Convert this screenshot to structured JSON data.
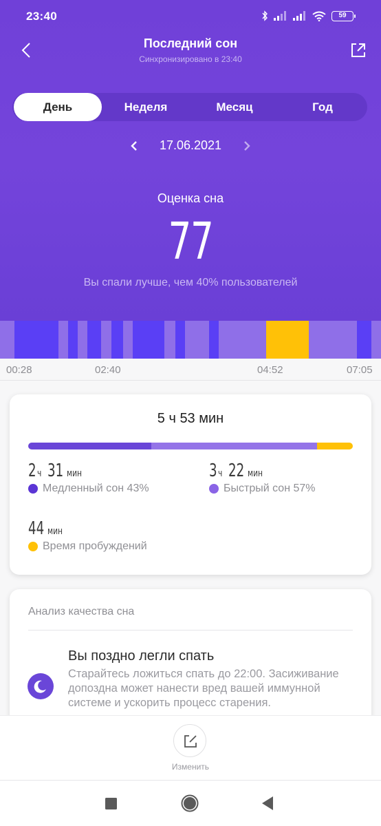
{
  "status_bar": {
    "time": "23:40",
    "battery_level": "59",
    "icons": [
      "bluetooth-icon",
      "signal-icon",
      "signal-icon",
      "wifi-icon",
      "battery-icon"
    ]
  },
  "header": {
    "title": "Последний сон",
    "subtitle": "Синхронизировано в 23:40",
    "back_icon": "chevron-left-icon",
    "share_icon": "share-icon"
  },
  "tabs": [
    {
      "label": "День",
      "active": true
    },
    {
      "label": "Неделя",
      "active": false
    },
    {
      "label": "Месяц",
      "active": false
    },
    {
      "label": "Год",
      "active": false
    }
  ],
  "date_nav": {
    "date": "17.06.2021",
    "prev_icon": "chevron-left-icon",
    "next_icon": "chevron-right-icon"
  },
  "score": {
    "label": "Оценка сна",
    "value": "77",
    "note": "Вы спали лучше, чем 40% пользователей"
  },
  "colors": {
    "deep": "#5a3ff5",
    "light": "#8f6fe8",
    "awake": "#ffc107",
    "deep_dot": "#5b35d5",
    "light_dot": "#8a64e6",
    "accent": "#7143da"
  },
  "chart_data": {
    "type": "timeline",
    "title": "",
    "x_start": "00:28",
    "x_end": "07:05",
    "total_minutes": 397,
    "tick_labels": [
      "00:28",
      "02:40",
      "04:52",
      "07:05"
    ],
    "segments": [
      {
        "stage": "light",
        "start_min": 0,
        "end_min": 15
      },
      {
        "stage": "deep",
        "start_min": 15,
        "end_min": 61
      },
      {
        "stage": "light",
        "start_min": 61,
        "end_min": 71
      },
      {
        "stage": "deep",
        "start_min": 71,
        "end_min": 81
      },
      {
        "stage": "light",
        "start_min": 81,
        "end_min": 91
      },
      {
        "stage": "deep",
        "start_min": 91,
        "end_min": 105
      },
      {
        "stage": "light",
        "start_min": 105,
        "end_min": 116
      },
      {
        "stage": "deep",
        "start_min": 116,
        "end_min": 128
      },
      {
        "stage": "light",
        "start_min": 128,
        "end_min": 138
      },
      {
        "stage": "deep",
        "start_min": 138,
        "end_min": 171
      },
      {
        "stage": "light",
        "start_min": 171,
        "end_min": 183
      },
      {
        "stage": "deep",
        "start_min": 183,
        "end_min": 193
      },
      {
        "stage": "light",
        "start_min": 193,
        "end_min": 218
      },
      {
        "stage": "deep",
        "start_min": 218,
        "end_min": 228
      },
      {
        "stage": "light",
        "start_min": 228,
        "end_min": 277
      },
      {
        "stage": "awake",
        "start_min": 277,
        "end_min": 322
      },
      {
        "stage": "light",
        "start_min": 322,
        "end_min": 372
      },
      {
        "stage": "deep",
        "start_min": 372,
        "end_min": 387
      },
      {
        "stage": "light",
        "start_min": 387,
        "end_min": 397
      }
    ]
  },
  "summary": {
    "total": "5 ч 53 мин",
    "bar_fractions": {
      "deep": 0.38,
      "light": 0.51,
      "awake": 0.11
    },
    "deep": {
      "hours": "2",
      "h_unit": "ч",
      "minutes": "31",
      "m_unit": "мин",
      "label": "Медленный сон 43%"
    },
    "light": {
      "hours": "3",
      "h_unit": "ч",
      "minutes": "22",
      "m_unit": "мин",
      "label": "Быстрый сон 57%"
    },
    "awake": {
      "minutes": "44",
      "m_unit": "мин",
      "label": "Время пробуждений"
    }
  },
  "analysis": {
    "title": "Анализ качества сна",
    "item_icon": "moon-icon",
    "item_heading": "Вы поздно легли спать",
    "item_body": "Старайтесь ложиться спать до 22:00. Засиживание допоздна может нанести вред вашей иммунной системе и ускорить процесс старения."
  },
  "bottom": {
    "edit_label": "Изменить",
    "edit_icon": "edit-icon"
  },
  "navbar": {
    "buttons": [
      "recents-icon",
      "home-icon",
      "back-icon"
    ]
  }
}
